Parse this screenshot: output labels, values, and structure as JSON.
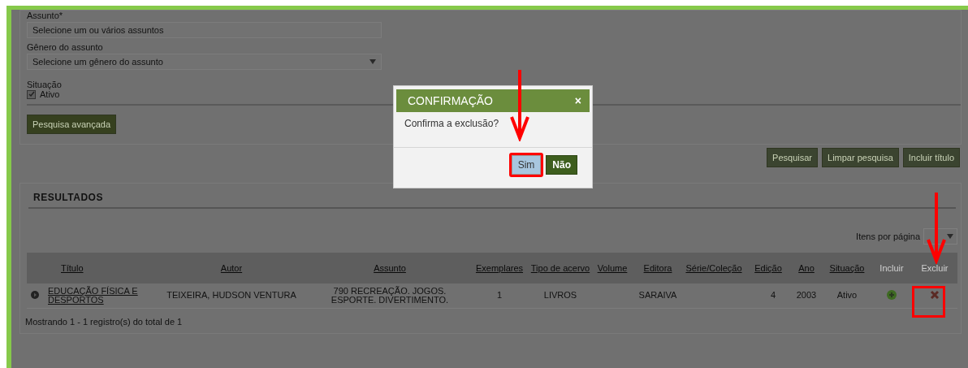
{
  "search_form": {
    "fields": [
      {
        "label": "Assunto*",
        "kind": "text",
        "placeholder": "Selecione um ou vários assuntos"
      },
      {
        "label": "Gênero do assunto",
        "kind": "select",
        "placeholder": "Selecione um gênero do assunto"
      }
    ],
    "situacao": {
      "label": "Situação",
      "option": {
        "label": "Ativo",
        "checked": true
      }
    },
    "advanced_button": "Pesquisa avançada",
    "actions": [
      "Pesquisar",
      "Limpar pesquisa",
      "Incluir título"
    ]
  },
  "results": {
    "title": "RESULTADOS",
    "per_page_label": "Itens por página",
    "columns": [
      {
        "label": "Título",
        "sortable": true
      },
      {
        "label": "Autor",
        "sortable": true
      },
      {
        "label": "Assunto",
        "sortable": true
      },
      {
        "label": "Exemplares",
        "sortable": true
      },
      {
        "label": "Tipo de acervo",
        "sortable": true
      },
      {
        "label": "Volume",
        "sortable": true
      },
      {
        "label": "Editora",
        "sortable": true
      },
      {
        "label": "Série/Coleção",
        "sortable": true
      },
      {
        "label": "Edição",
        "sortable": true
      },
      {
        "label": "Ano",
        "sortable": true
      },
      {
        "label": "Situação",
        "sortable": true
      },
      {
        "label": "Incluir",
        "sortable": false
      },
      {
        "label": "Excluir",
        "sortable": false
      }
    ],
    "rows": [
      {
        "cells": [
          "EDUCAÇÃO FÍSICA E DESPORTOS",
          "TEIXEIRA, HUDSON VENTURA",
          "790 RECREAÇÃO. JOGOS. ESPORTE. DIVERTIMENTO.",
          "1",
          "LIVROS",
          "",
          "SARAIVA",
          "",
          "4",
          "2003",
          "Ativo"
        ],
        "highlighted": true
      }
    ],
    "summary": "Mostrando 1 - 1 registro(s) do total de 1"
  },
  "dialog": {
    "title": "CONFIRMAÇÃO",
    "close": "×",
    "message": "Confirma a exclusão?",
    "buttons": [
      {
        "label": "Sim",
        "kind": "secondary",
        "highlighted": true
      },
      {
        "label": "Não",
        "kind": "primary",
        "highlighted": false
      }
    ]
  }
}
